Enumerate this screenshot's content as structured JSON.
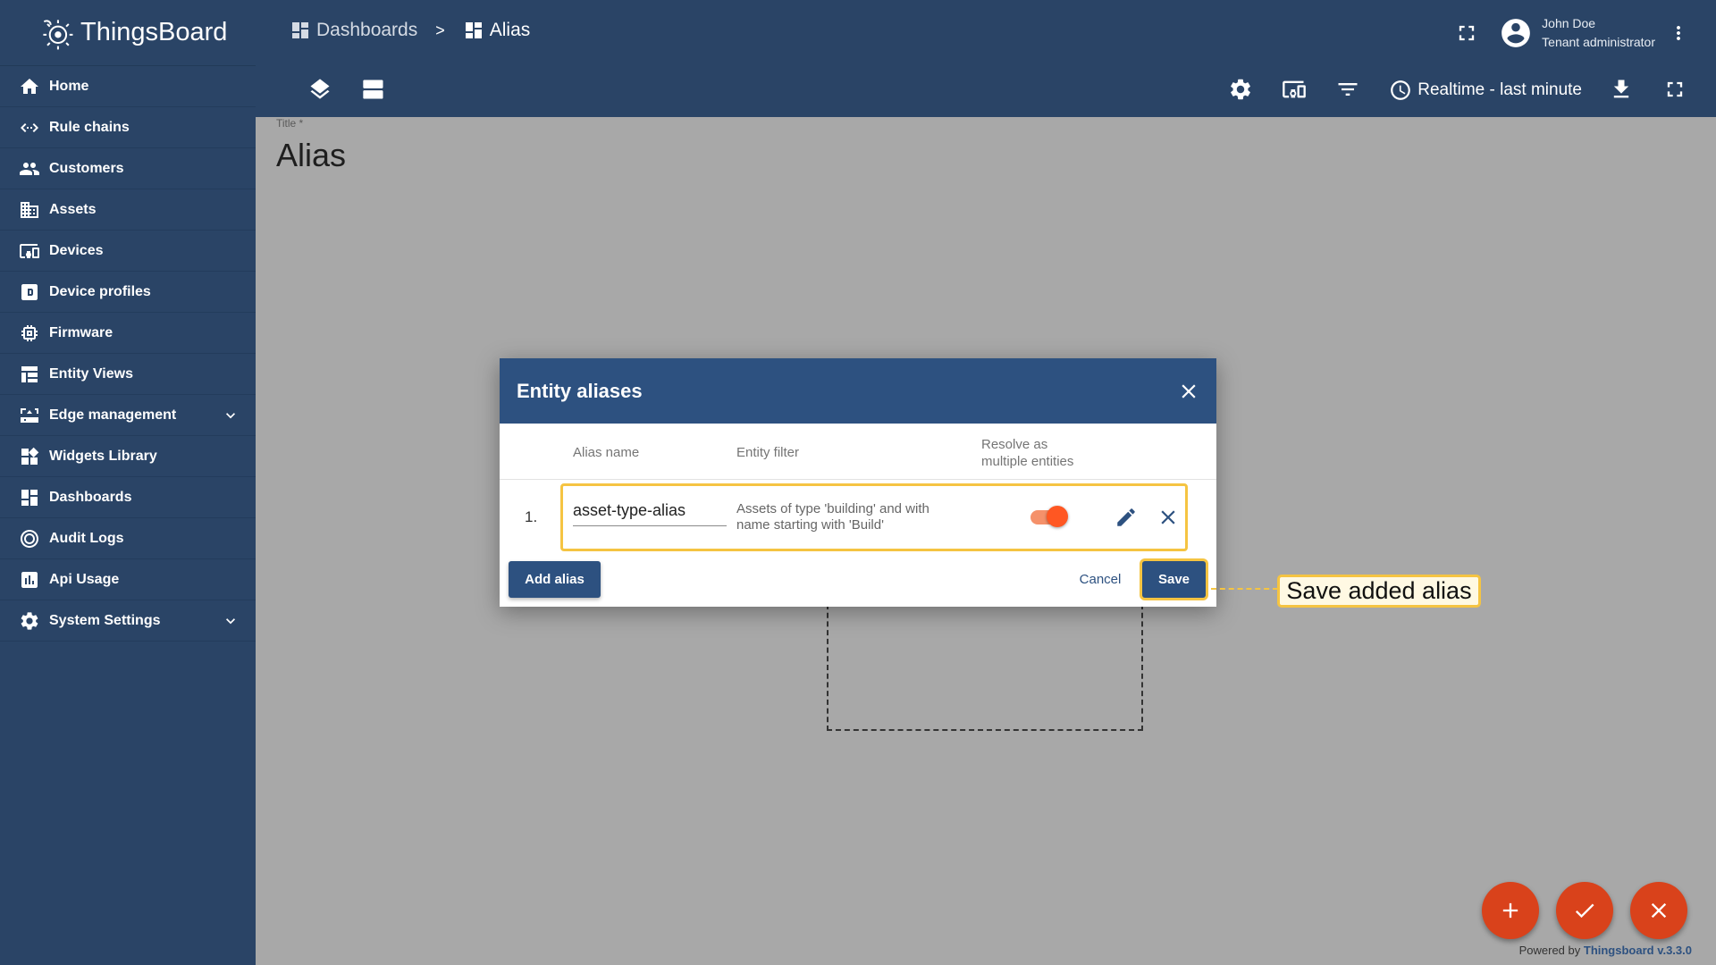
{
  "app": {
    "name": "ThingsBoard"
  },
  "sidebar": {
    "items": [
      {
        "label": "Home",
        "icon": "home-icon"
      },
      {
        "label": "Rule chains",
        "icon": "rule-chain-icon"
      },
      {
        "label": "Customers",
        "icon": "customers-icon"
      },
      {
        "label": "Assets",
        "icon": "assets-icon"
      },
      {
        "label": "Devices",
        "icon": "devices-icon"
      },
      {
        "label": "Device profiles",
        "icon": "device-profile-icon"
      },
      {
        "label": "Firmware",
        "icon": "firmware-icon"
      },
      {
        "label": "Entity Views",
        "icon": "entity-views-icon"
      },
      {
        "label": "Edge management",
        "icon": "edge-icon",
        "expandable": true
      },
      {
        "label": "Widgets Library",
        "icon": "widgets-icon"
      },
      {
        "label": "Dashboards",
        "icon": "dashboards-icon"
      },
      {
        "label": "Audit Logs",
        "icon": "audit-icon"
      },
      {
        "label": "Api Usage",
        "icon": "api-usage-icon"
      },
      {
        "label": "System Settings",
        "icon": "settings-icon",
        "expandable": true
      }
    ]
  },
  "header": {
    "breadcrumb": [
      {
        "label": "Dashboards"
      },
      {
        "label": "Alias"
      }
    ],
    "breadcrumb_separator": ">",
    "user": {
      "name": "John Doe",
      "role": "Tenant administrator"
    },
    "timewindow": "Realtime - last minute"
  },
  "content": {
    "title_label": "Title *",
    "title_value": "Alias"
  },
  "dialog": {
    "title": "Entity aliases",
    "columns": {
      "alias_name": "Alias name",
      "entity_filter": "Entity filter",
      "resolve_line1": "Resolve as",
      "resolve_line2": "multiple entities"
    },
    "rows": [
      {
        "index": "1.",
        "alias_name": "asset-type-alias",
        "entity_filter": "Assets of type 'building' and with name starting with 'Build'",
        "resolve_multiple": true
      }
    ],
    "add_alias_label": "Add alias",
    "cancel_label": "Cancel",
    "save_label": "Save"
  },
  "callout": {
    "text": "Save added alias"
  },
  "footer": {
    "powered_prefix": "Powered by",
    "powered_link": "Thingsboard v.3.3.0"
  },
  "colors": {
    "primary": "#2d5180",
    "sidebar": "#2a4466",
    "accent": "#ff5722",
    "highlight": "#f5c442",
    "fab": "#d9421b"
  }
}
